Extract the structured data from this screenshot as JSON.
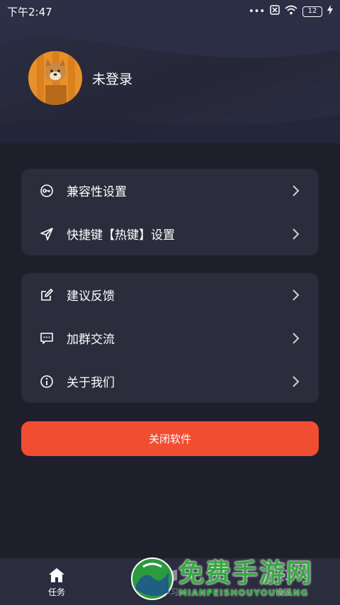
{
  "status_bar": {
    "time": "下午2:47",
    "dots": "•••",
    "battery": "12"
  },
  "profile": {
    "name": "未登录"
  },
  "card1": {
    "items": [
      {
        "label": "兼容性设置",
        "icon": "key-icon"
      },
      {
        "label": "快捷键【热键】设置",
        "icon": "send-icon"
      }
    ]
  },
  "card2": {
    "items": [
      {
        "label": "建议反馈",
        "icon": "edit-icon"
      },
      {
        "label": "加群交流",
        "icon": "chat-icon"
      },
      {
        "label": "关于我们",
        "icon": "info-icon"
      }
    ]
  },
  "close_button": {
    "label": "关闭软件"
  },
  "bottom_nav": {
    "items": [
      {
        "label": "任务",
        "icon": "home-icon"
      },
      {
        "label": "学习",
        "icon": "book-icon"
      },
      {
        "label": "设置",
        "icon": "gear-icon"
      }
    ]
  },
  "watermark": {
    "title": "免费手游网",
    "subtitle": "MIANFEISHOUYOUWANG"
  },
  "colors": {
    "background": "#1f1f2b",
    "card": "#2b2c3c",
    "accent": "#f14d31",
    "watermark": "#38a844"
  }
}
